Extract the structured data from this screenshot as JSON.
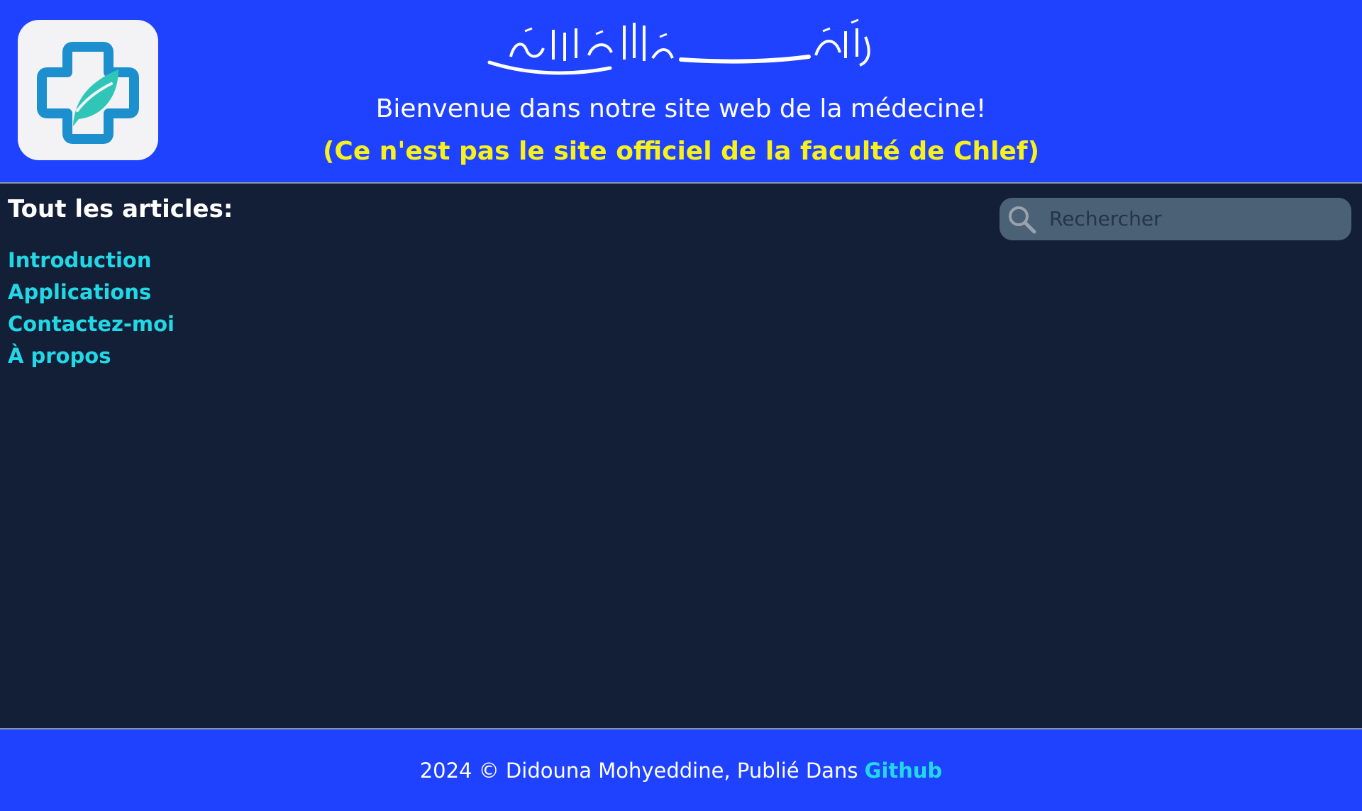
{
  "header": {
    "basmala": "بِسْمِ ٱللَّٰهِ ٱلرَّحْمَٰنِ ٱلرَّحِيمِ",
    "welcome": "Bienvenue dans notre site web de la médecine!",
    "disclaimer": "(Ce n'est pas le site officiel de la faculté de Chlef)",
    "logo_icon": "medical-cross-leaf-icon"
  },
  "main": {
    "articles_title": "Tout les articles:",
    "articles": [
      {
        "label": "Introduction"
      },
      {
        "label": "Applications"
      },
      {
        "label": "Contactez-moi"
      },
      {
        "label": "À propos"
      }
    ],
    "search": {
      "placeholder": "Rechercher",
      "value": "",
      "icon": "search-icon"
    }
  },
  "footer": {
    "text": "2024 © Didouna Mohyeddine, Publié Dans",
    "link_label": "Github"
  },
  "colors": {
    "header_bg": "#1e42ff",
    "body_bg": "#131e37",
    "link": "#22d8e6",
    "disclaimer": "#f8f21a",
    "search_bg": "#4a6176"
  }
}
